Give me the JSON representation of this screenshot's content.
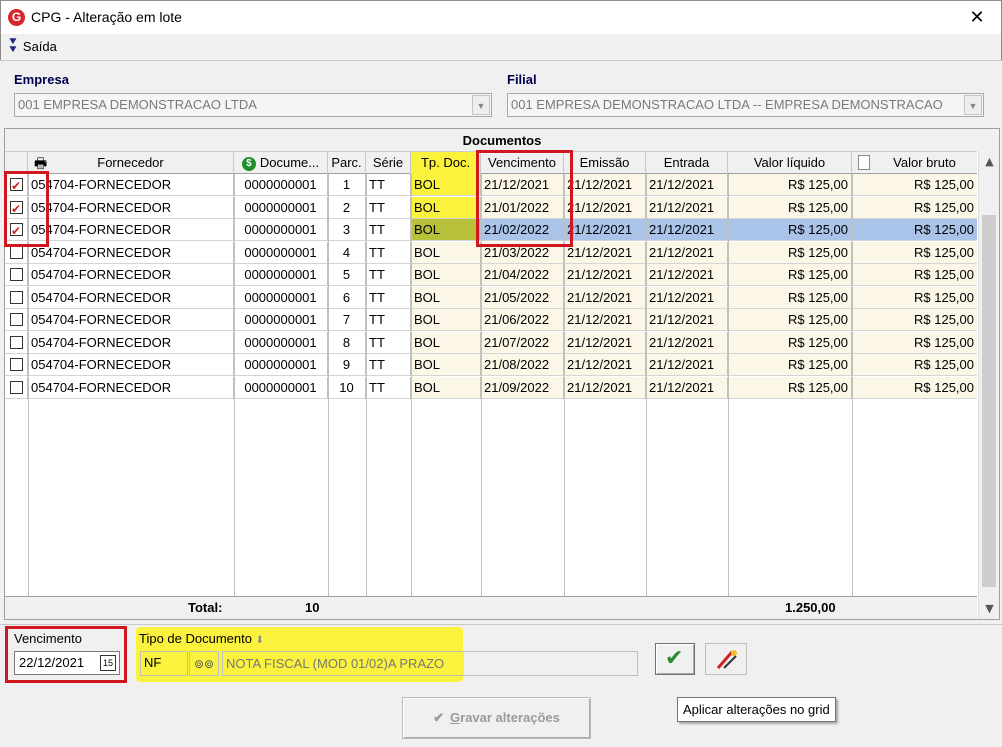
{
  "window": {
    "title": "CPG - Alteração em lote",
    "app_icon_glyph": "G",
    "close_glyph": "✕"
  },
  "menu": {
    "exit_label": "Saída"
  },
  "empresa": {
    "label": "Empresa",
    "value": "001 EMPRESA DEMONSTRACAO LTDA"
  },
  "filial": {
    "label": "Filial",
    "value": "001 EMPRESA DEMONSTRACAO LTDA -- EMPRESA DEMONSTRACAO"
  },
  "grid": {
    "caption": "Documentos",
    "headers": {
      "fornecedor": "Fornecedor",
      "documento": "Docume...",
      "parc": "Parc.",
      "serie": "Série",
      "tpdoc": "Tp. Doc.",
      "vencimento": "Vencimento",
      "emissao": "Emissão",
      "entrada": "Entrada",
      "valor_liquido": "Valor líquido",
      "valor_bruto": "Valor bruto"
    },
    "rows": [
      {
        "checked": true,
        "fornecedor": "054704-FORNECEDOR",
        "documento": "0000000001",
        "parc": "1",
        "serie": "TT",
        "tpdoc": "BOL",
        "vencimento": "21/12/2021",
        "emissao": "21/12/2021",
        "entrada": "21/12/2021",
        "valor_liquido": "R$ 125,00",
        "valor_bruto": "R$ 125,00"
      },
      {
        "checked": true,
        "fornecedor": "054704-FORNECEDOR",
        "documento": "0000000001",
        "parc": "2",
        "serie": "TT",
        "tpdoc": "BOL",
        "vencimento": "21/01/2022",
        "emissao": "21/12/2021",
        "entrada": "21/12/2021",
        "valor_liquido": "R$ 125,00",
        "valor_bruto": "R$ 125,00"
      },
      {
        "checked": true,
        "fornecedor": "054704-FORNECEDOR",
        "documento": "0000000001",
        "parc": "3",
        "serie": "TT",
        "tpdoc": "BOL",
        "vencimento": "21/02/2022",
        "emissao": "21/12/2021",
        "entrada": "21/12/2021",
        "valor_liquido": "R$ 125,00",
        "valor_bruto": "R$ 125,00",
        "selected": true
      },
      {
        "checked": false,
        "fornecedor": "054704-FORNECEDOR",
        "documento": "0000000001",
        "parc": "4",
        "serie": "TT",
        "tpdoc": "BOL",
        "vencimento": "21/03/2022",
        "emissao": "21/12/2021",
        "entrada": "21/12/2021",
        "valor_liquido": "R$ 125,00",
        "valor_bruto": "R$ 125,00"
      },
      {
        "checked": false,
        "fornecedor": "054704-FORNECEDOR",
        "documento": "0000000001",
        "parc": "5",
        "serie": "TT",
        "tpdoc": "BOL",
        "vencimento": "21/04/2022",
        "emissao": "21/12/2021",
        "entrada": "21/12/2021",
        "valor_liquido": "R$ 125,00",
        "valor_bruto": "R$ 125,00"
      },
      {
        "checked": false,
        "fornecedor": "054704-FORNECEDOR",
        "documento": "0000000001",
        "parc": "6",
        "serie": "TT",
        "tpdoc": "BOL",
        "vencimento": "21/05/2022",
        "emissao": "21/12/2021",
        "entrada": "21/12/2021",
        "valor_liquido": "R$ 125,00",
        "valor_bruto": "R$ 125,00"
      },
      {
        "checked": false,
        "fornecedor": "054704-FORNECEDOR",
        "documento": "0000000001",
        "parc": "7",
        "serie": "TT",
        "tpdoc": "BOL",
        "vencimento": "21/06/2022",
        "emissao": "21/12/2021",
        "entrada": "21/12/2021",
        "valor_liquido": "R$ 125,00",
        "valor_bruto": "R$ 125,00"
      },
      {
        "checked": false,
        "fornecedor": "054704-FORNECEDOR",
        "documento": "0000000001",
        "parc": "8",
        "serie": "TT",
        "tpdoc": "BOL",
        "vencimento": "21/07/2022",
        "emissao": "21/12/2021",
        "entrada": "21/12/2021",
        "valor_liquido": "R$ 125,00",
        "valor_bruto": "R$ 125,00"
      },
      {
        "checked": false,
        "fornecedor": "054704-FORNECEDOR",
        "documento": "0000000001",
        "parc": "9",
        "serie": "TT",
        "tpdoc": "BOL",
        "vencimento": "21/08/2022",
        "emissao": "21/12/2021",
        "entrada": "21/12/2021",
        "valor_liquido": "R$ 125,00",
        "valor_bruto": "R$ 125,00"
      },
      {
        "checked": false,
        "fornecedor": "054704-FORNECEDOR",
        "documento": "0000000001",
        "parc": "10",
        "serie": "TT",
        "tpdoc": "BOL",
        "vencimento": "21/09/2022",
        "emissao": "21/12/2021",
        "entrada": "21/12/2021",
        "valor_liquido": "R$ 125,00",
        "valor_bruto": "R$ 125,00"
      }
    ],
    "totals": {
      "label": "Total:",
      "count": "10",
      "valor_liquido": "1.250,00"
    }
  },
  "bottom": {
    "vencimento_label": "Vencimento",
    "vencimento_value": "22/12/2021",
    "calendar_glyph": "15",
    "tipo_label": "Tipo de Documento",
    "tipo_code": "NF",
    "tipo_desc": "NOTA FISCAL (MOD 01/02)A PRAZO",
    "tooltip": "Aplicar alterações no grid",
    "save_prefix": "G",
    "save_rest": "ravar alterações"
  },
  "colors": {
    "highlight_yellow": "#fbf23d",
    "annotation_red": "#d0161f",
    "selected_row": "#a9c4e8"
  },
  "icons": [
    "app-logo-icon",
    "close-icon",
    "exit-icon",
    "printer-icon",
    "dollar-icon",
    "document-icon",
    "dropdown-arrow-icon",
    "calendar-icon",
    "binoculars-icon",
    "checkmark-icon",
    "eraser-icon",
    "scroll-up-icon",
    "scroll-down-icon"
  ]
}
